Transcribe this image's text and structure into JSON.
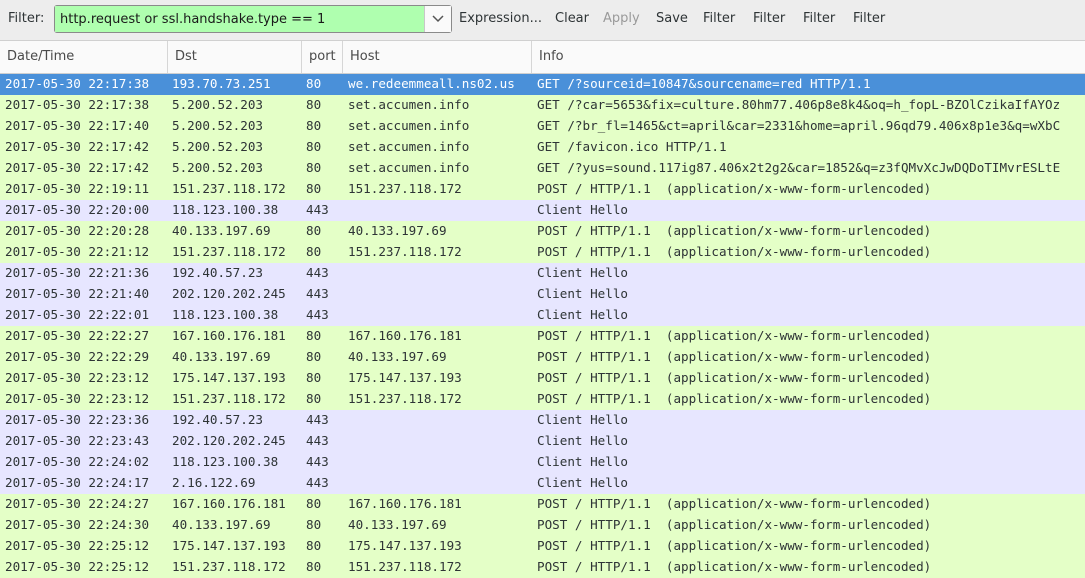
{
  "toolbar": {
    "filter_label": "Filter:",
    "filter_value": "http.request or ssl.handshake.type == 1",
    "buttons": [
      "Expression...",
      "Clear",
      "Apply",
      "Save",
      "Filter",
      "Filter",
      "Filter",
      "Filter"
    ],
    "disabled": [
      "Apply"
    ]
  },
  "columns": [
    "Date/Time",
    "Dst",
    "port",
    "Host",
    "Info"
  ],
  "colors": {
    "http_row": "#e4ffc7",
    "tls_row": "#e7e6ff",
    "selected_row": "#4a90d9"
  },
  "rows": [
    {
      "type": "http",
      "selected": true,
      "date": "2017-05-30 22:17:38",
      "dst": "193.70.73.251",
      "port": "80",
      "host": "we.redeemmeall.ns02.us",
      "info": "GET /?sourceid=10847&sourcename=red HTTP/1.1"
    },
    {
      "type": "http",
      "date": "2017-05-30 22:17:38",
      "dst": "5.200.52.203",
      "port": "80",
      "host": "set.accumen.info",
      "info": "GET /?car=5653&fix=culture.80hm77.406p8e8k4&oq=h_fopL-BZOlCzikaIfAYOz"
    },
    {
      "type": "http",
      "date": "2017-05-30 22:17:40",
      "dst": "5.200.52.203",
      "port": "80",
      "host": "set.accumen.info",
      "info": "GET /?br_fl=1465&ct=april&car=2331&home=april.96qd79.406x8p1e3&q=wXbC"
    },
    {
      "type": "http",
      "date": "2017-05-30 22:17:42",
      "dst": "5.200.52.203",
      "port": "80",
      "host": "set.accumen.info",
      "info": "GET /favicon.ico HTTP/1.1"
    },
    {
      "type": "http",
      "date": "2017-05-30 22:17:42",
      "dst": "5.200.52.203",
      "port": "80",
      "host": "set.accumen.info",
      "info": "GET /?yus=sound.117ig87.406x2t2g2&car=1852&q=z3fQMvXcJwDQDoTIMvrESLtE"
    },
    {
      "type": "http",
      "date": "2017-05-30 22:19:11",
      "dst": "151.237.118.172",
      "port": "80",
      "host": "151.237.118.172",
      "info": "POST / HTTP/1.1  (application/x-www-form-urlencoded)"
    },
    {
      "type": "tls",
      "date": "2017-05-30 22:20:00",
      "dst": "118.123.100.38",
      "port": "443",
      "host": "",
      "info": "Client Hello"
    },
    {
      "type": "http",
      "date": "2017-05-30 22:20:28",
      "dst": "40.133.197.69",
      "port": "80",
      "host": "40.133.197.69",
      "info": "POST / HTTP/1.1  (application/x-www-form-urlencoded)"
    },
    {
      "type": "http",
      "date": "2017-05-30 22:21:12",
      "dst": "151.237.118.172",
      "port": "80",
      "host": "151.237.118.172",
      "info": "POST / HTTP/1.1  (application/x-www-form-urlencoded)"
    },
    {
      "type": "tls",
      "date": "2017-05-30 22:21:36",
      "dst": "192.40.57.23",
      "port": "443",
      "host": "",
      "info": "Client Hello"
    },
    {
      "type": "tls",
      "date": "2017-05-30 22:21:40",
      "dst": "202.120.202.245",
      "port": "443",
      "host": "",
      "info": "Client Hello"
    },
    {
      "type": "tls",
      "date": "2017-05-30 22:22:01",
      "dst": "118.123.100.38",
      "port": "443",
      "host": "",
      "info": "Client Hello"
    },
    {
      "type": "http",
      "date": "2017-05-30 22:22:27",
      "dst": "167.160.176.181",
      "port": "80",
      "host": "167.160.176.181",
      "info": "POST / HTTP/1.1  (application/x-www-form-urlencoded)"
    },
    {
      "type": "http",
      "date": "2017-05-30 22:22:29",
      "dst": "40.133.197.69",
      "port": "80",
      "host": "40.133.197.69",
      "info": "POST / HTTP/1.1  (application/x-www-form-urlencoded)"
    },
    {
      "type": "http",
      "date": "2017-05-30 22:23:12",
      "dst": "175.147.137.193",
      "port": "80",
      "host": "175.147.137.193",
      "info": "POST / HTTP/1.1  (application/x-www-form-urlencoded)"
    },
    {
      "type": "http",
      "date": "2017-05-30 22:23:12",
      "dst": "151.237.118.172",
      "port": "80",
      "host": "151.237.118.172",
      "info": "POST / HTTP/1.1  (application/x-www-form-urlencoded)"
    },
    {
      "type": "tls",
      "date": "2017-05-30 22:23:36",
      "dst": "192.40.57.23",
      "port": "443",
      "host": "",
      "info": "Client Hello"
    },
    {
      "type": "tls",
      "date": "2017-05-30 22:23:43",
      "dst": "202.120.202.245",
      "port": "443",
      "host": "",
      "info": "Client Hello"
    },
    {
      "type": "tls",
      "date": "2017-05-30 22:24:02",
      "dst": "118.123.100.38",
      "port": "443",
      "host": "",
      "info": "Client Hello"
    },
    {
      "type": "tls",
      "date": "2017-05-30 22:24:17",
      "dst": "2.16.122.69",
      "port": "443",
      "host": "",
      "info": "Client Hello"
    },
    {
      "type": "http",
      "date": "2017-05-30 22:24:27",
      "dst": "167.160.176.181",
      "port": "80",
      "host": "167.160.176.181",
      "info": "POST / HTTP/1.1  (application/x-www-form-urlencoded)"
    },
    {
      "type": "http",
      "date": "2017-05-30 22:24:30",
      "dst": "40.133.197.69",
      "port": "80",
      "host": "40.133.197.69",
      "info": "POST / HTTP/1.1  (application/x-www-form-urlencoded)"
    },
    {
      "type": "http",
      "date": "2017-05-30 22:25:12",
      "dst": "175.147.137.193",
      "port": "80",
      "host": "175.147.137.193",
      "info": "POST / HTTP/1.1  (application/x-www-form-urlencoded)"
    },
    {
      "type": "http",
      "date": "2017-05-30 22:25:12",
      "dst": "151.237.118.172",
      "port": "80",
      "host": "151.237.118.172",
      "info": "POST / HTTP/1.1  (application/x-www-form-urlencoded)"
    }
  ]
}
